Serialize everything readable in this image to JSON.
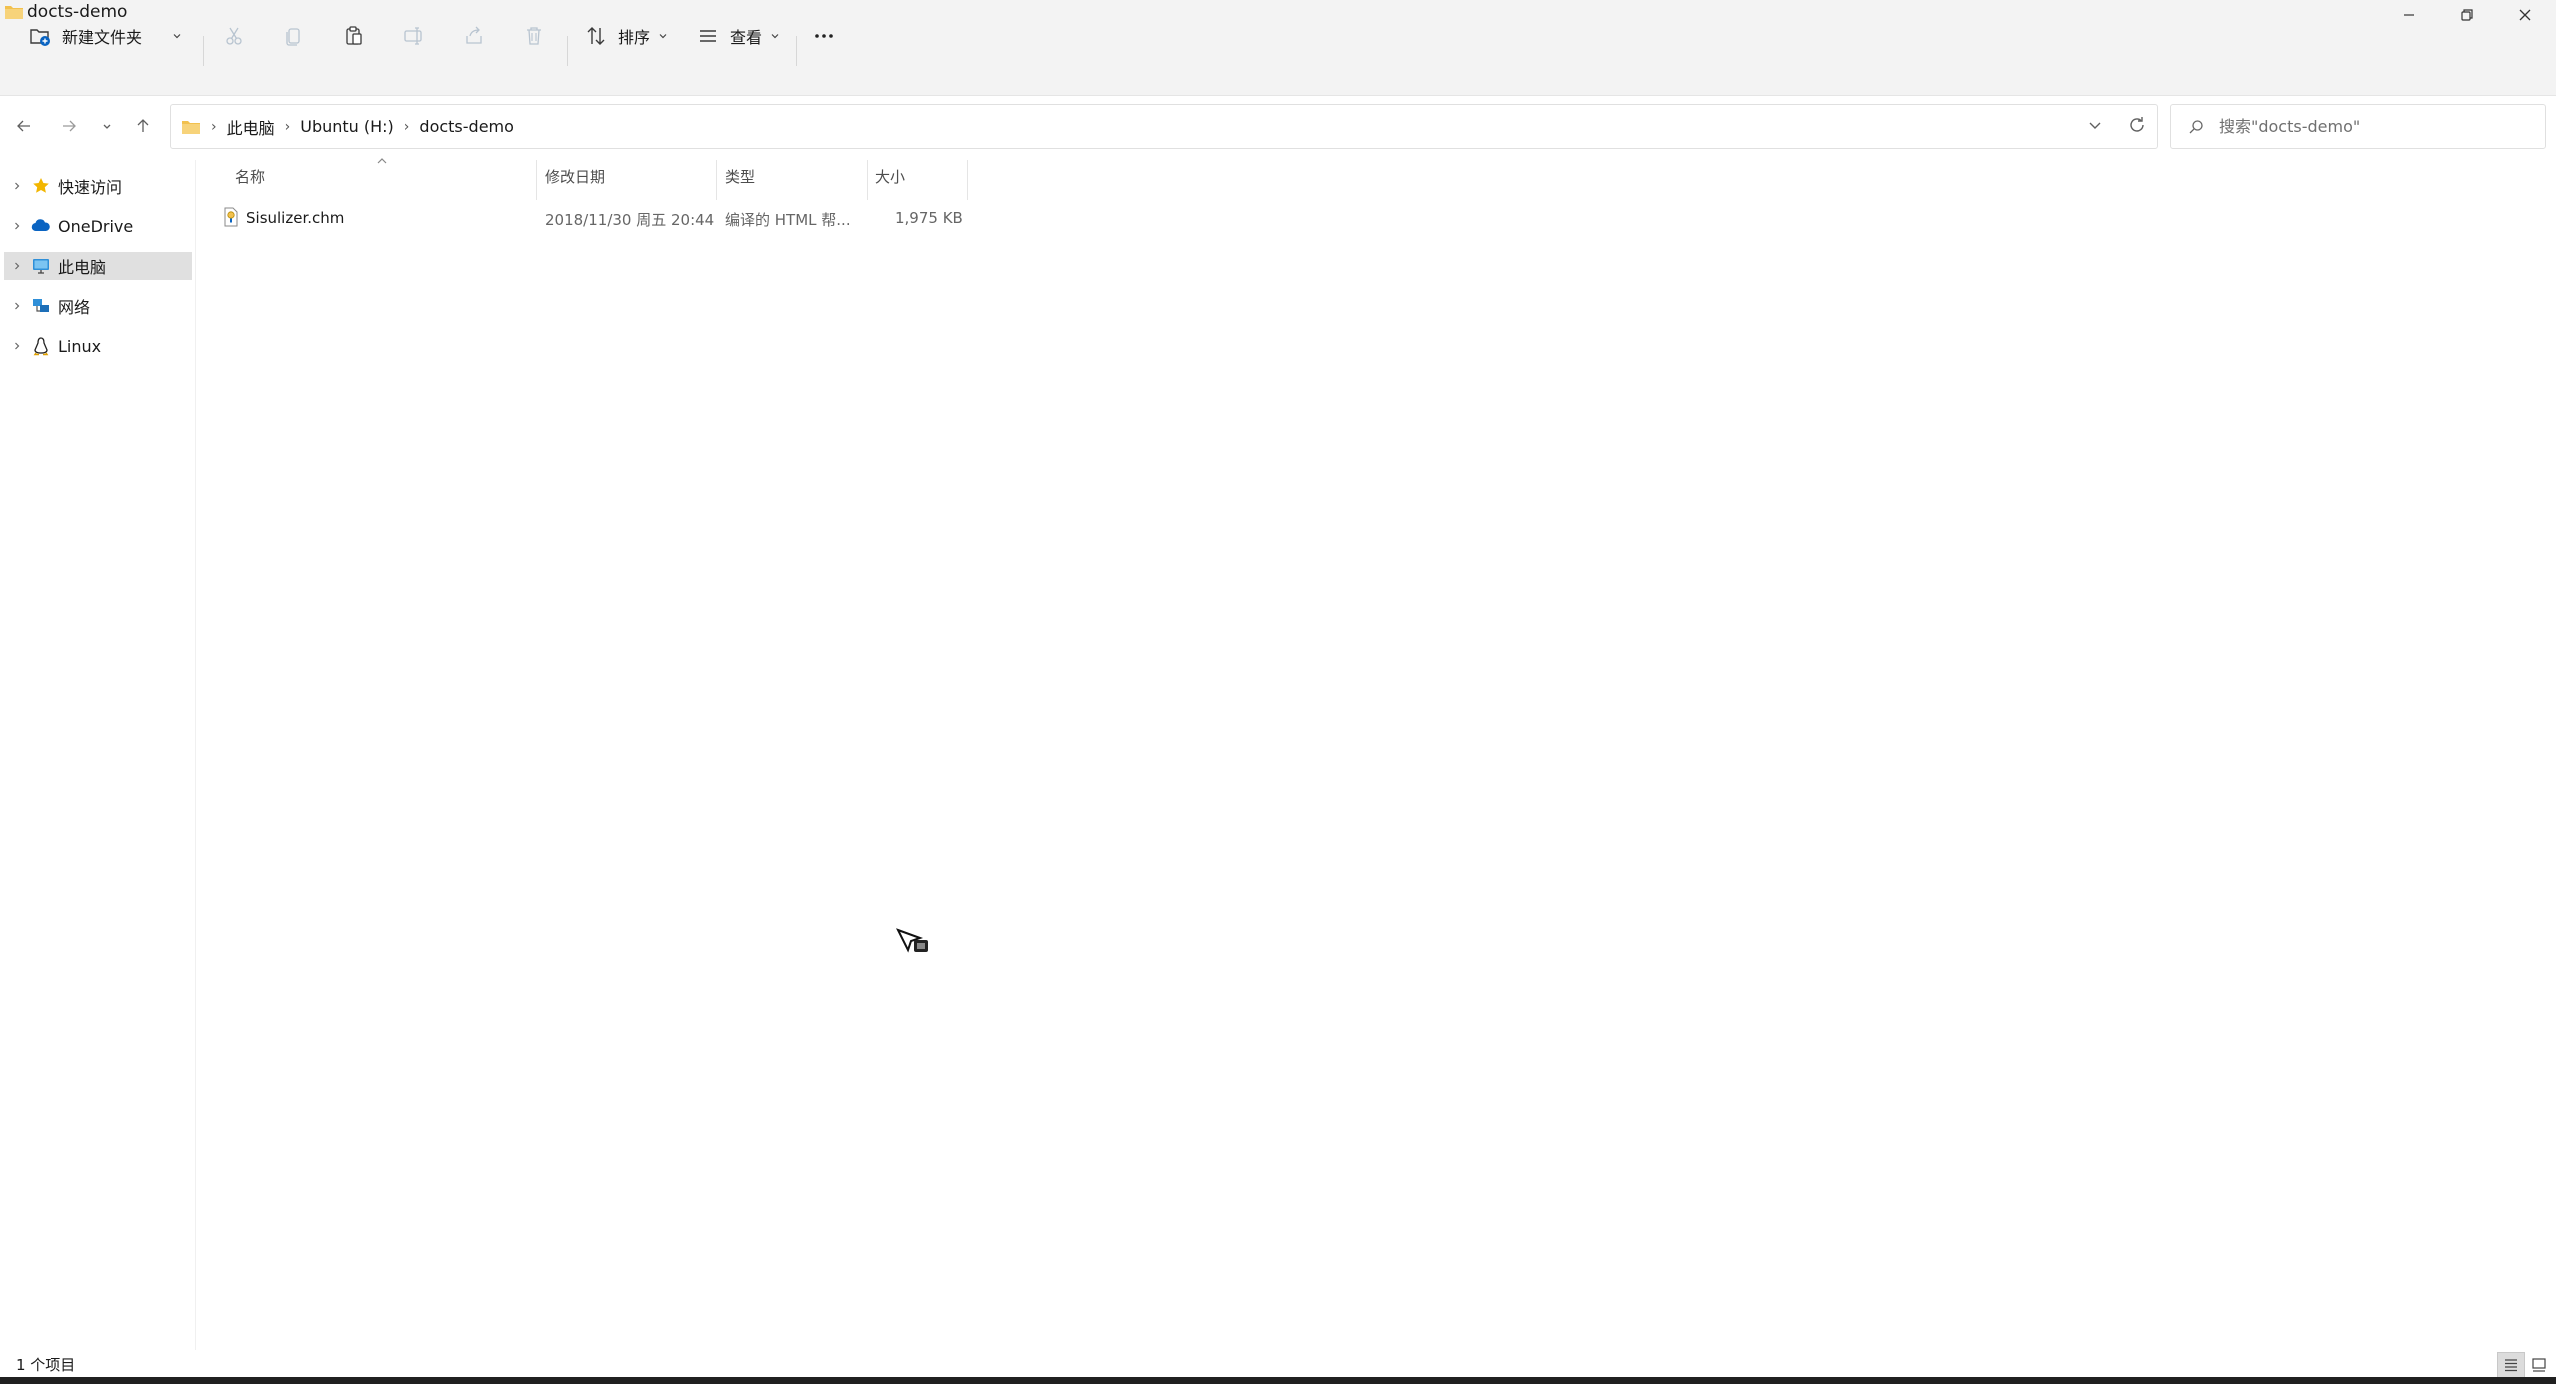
{
  "window": {
    "title": "docts-demo"
  },
  "toolbar": {
    "new_label": "新建文件夹",
    "sort_label": "排序",
    "view_label": "查看"
  },
  "address": {
    "crumbs": [
      "此电脑",
      "Ubuntu (H:)",
      "docts-demo"
    ]
  },
  "search": {
    "placeholder": "搜索\"docts-demo\""
  },
  "sidebar": {
    "items": [
      {
        "label": "快速访问",
        "icon": "star-icon"
      },
      {
        "label": "OneDrive",
        "icon": "cloud-icon"
      },
      {
        "label": "此电脑",
        "icon": "computer-icon",
        "selected": true
      },
      {
        "label": "网络",
        "icon": "network-icon"
      },
      {
        "label": "Linux",
        "icon": "linux-penguin-icon"
      }
    ]
  },
  "columns": {
    "name": "名称",
    "modified": "修改日期",
    "type": "类型",
    "size": "大小"
  },
  "files": [
    {
      "name": "Sisulizer.chm",
      "modified": "2018/11/30 周五 20:44",
      "type": "编译的 HTML 帮...",
      "size": "1,975 KB"
    }
  ],
  "status": {
    "count": "1 个项目"
  },
  "colors": {
    "chrome": "#f3f3f3",
    "selected": "#e0e0e0",
    "folder": "#f2c14e",
    "accent": "#0a64c2"
  }
}
